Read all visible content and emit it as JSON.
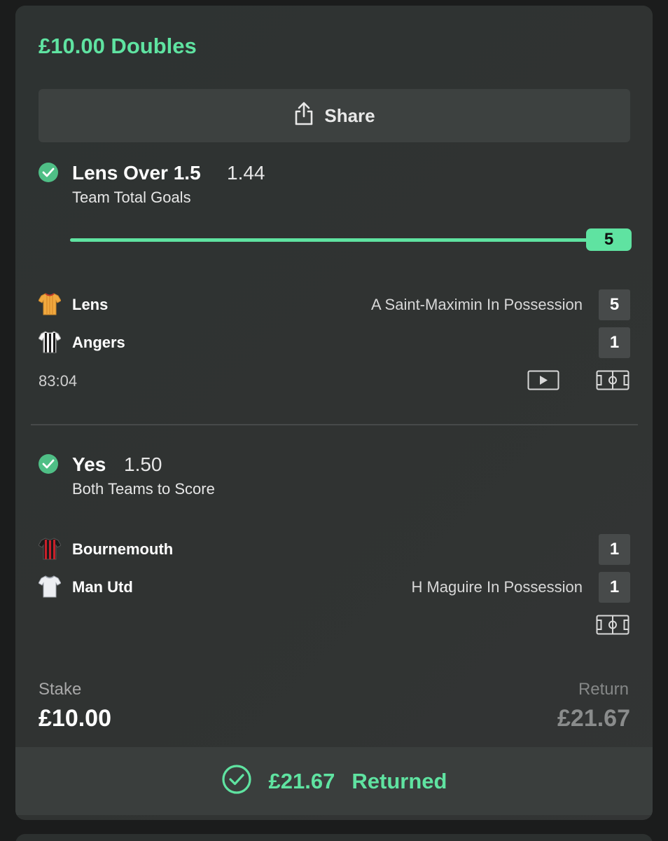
{
  "bet": {
    "title": "£10.00 Doubles",
    "share_label": "Share"
  },
  "selections": [
    {
      "name": "Lens Over 1.5",
      "odds": "1.44",
      "market": "Team Total Goals",
      "progress": {
        "current": 5,
        "current_label": "5",
        "fraction": 1.0
      },
      "teams": [
        {
          "name": "Lens",
          "possession": "A Saint-Maximin In Possession",
          "score": "5"
        },
        {
          "name": "Angers",
          "possession": "",
          "score": "1"
        }
      ],
      "clock": "83:04"
    },
    {
      "name": "Yes",
      "odds": "1.50",
      "market": "Both Teams to Score",
      "teams": [
        {
          "name": "Bournemouth",
          "possession": "",
          "score": "1"
        },
        {
          "name": "Man Utd",
          "possession": "H Maguire In Possession",
          "score": "1"
        }
      ]
    }
  ],
  "summary": {
    "stake_label": "Stake",
    "stake_value": "£10.00",
    "return_label": "Return",
    "return_value": "£21.67"
  },
  "footer": {
    "amount": "£21.67",
    "status": "Returned"
  },
  "colors": {
    "accent": "#5fe3a1",
    "check": "#4fbf86",
    "card_bg": "#303332"
  },
  "icons": [
    "share-icon",
    "check-circle-icon",
    "play-icon",
    "pitch-icon",
    "kit-icon"
  ]
}
